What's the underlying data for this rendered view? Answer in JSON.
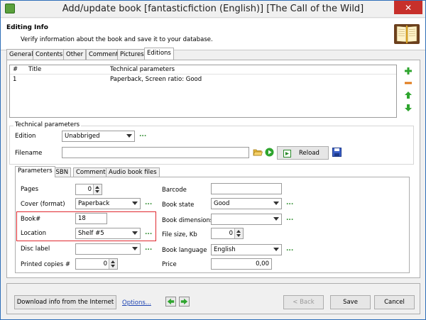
{
  "window": {
    "title": "Add/update book [fantasticfiction (English)] [The Call of the Wild]",
    "close_glyph": "✕"
  },
  "header": {
    "title": "Editing Info",
    "subtitle": "Verify information about the book and save it to your database."
  },
  "tabs": [
    {
      "label": "General"
    },
    {
      "label": "Contents"
    },
    {
      "label": "Other"
    },
    {
      "label": "Comment"
    },
    {
      "label": "Pictures"
    },
    {
      "label": "Editions"
    }
  ],
  "editions_list": {
    "columns": [
      "#",
      "Title",
      "Technical parameters"
    ],
    "rows": [
      {
        "num": "1",
        "title": "",
        "tech": "Paperback, Screen ratio: Good"
      }
    ]
  },
  "side_buttons": [
    "add-icon",
    "remove-icon",
    "move-up-icon",
    "move-down-icon"
  ],
  "technical": {
    "group_label": "Technical parameters",
    "edition_label": "Edition",
    "edition_value": "Unabbriged",
    "filename_label": "Filename",
    "filename_value": "",
    "reload_label": "Reload",
    "dots": "..."
  },
  "subtabs": [
    {
      "label": "Parameters"
    },
    {
      "label": "ISBN"
    },
    {
      "label": "Comment"
    },
    {
      "label": "Audio book files"
    }
  ],
  "params": {
    "pages_label": "Pages",
    "pages_value": "0",
    "cover_label": "Cover (format)",
    "cover_value": "Paperback",
    "book_num_label": "Book#",
    "book_num_value": "18",
    "location_label": "Location",
    "location_value": "Shelf #5",
    "disc_label": "Disc label",
    "disc_value": "",
    "printed_label": "Printed copies #",
    "printed_value": "0",
    "barcode_label": "Barcode",
    "barcode_value": "",
    "state_label": "Book state",
    "state_value": "Good",
    "dimensions_label": "Book dimensions",
    "dimensions_value": "",
    "filesize_label": "File size, Kb",
    "filesize_value": "0",
    "language_label": "Book language",
    "language_value": "English",
    "price_label": "Price",
    "price_value": "0,00"
  },
  "footer": {
    "download_label": "Download info from the Internet",
    "options_label": "Options...",
    "back_label": "< Back",
    "save_label": "Save",
    "cancel_label": "Cancel"
  },
  "colors": {
    "accent_green": "#2a8a2a",
    "highlight_red": "#e0292f",
    "close_red": "#c7302b",
    "link_blue": "#1c43b3"
  }
}
